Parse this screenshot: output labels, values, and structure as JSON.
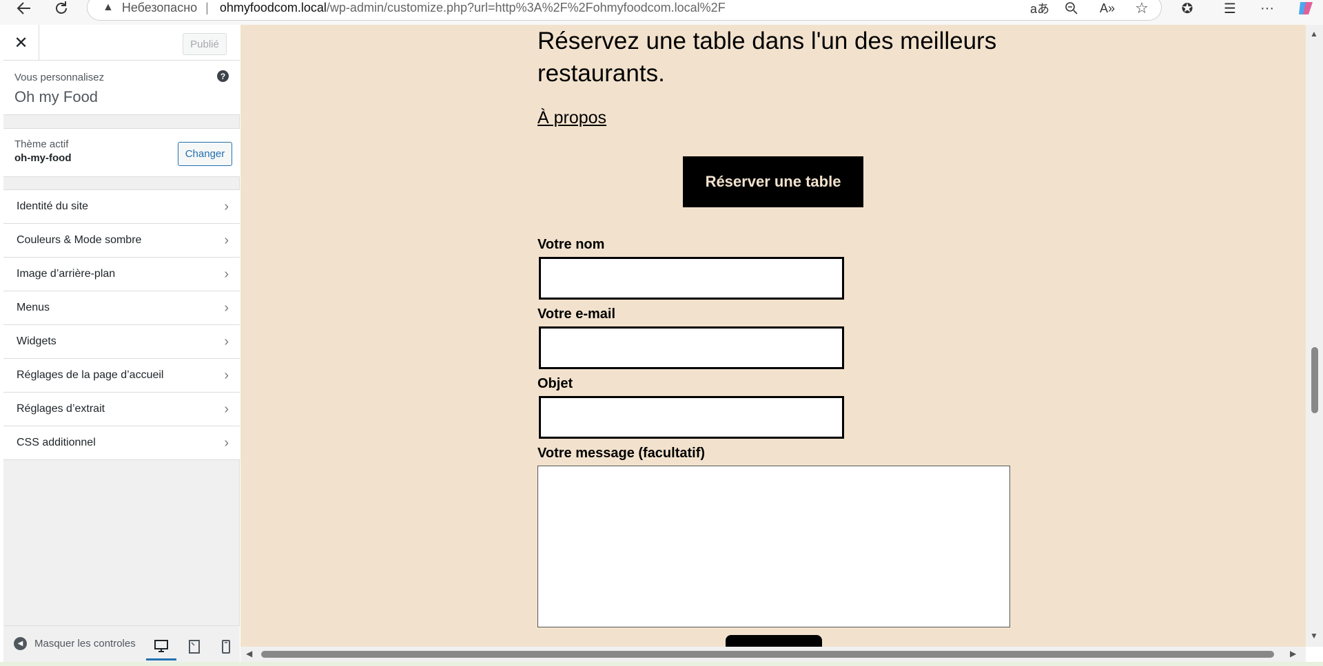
{
  "browser": {
    "back_icon": "arrow-left-icon",
    "refresh_icon": "refresh-icon",
    "security_label": "Небезопасно",
    "url_domain": "ohmyfoodcom.local",
    "url_path": "/wp-admin/customize.php?url=http%3A%2F%2Fohmyfoodcom.local%2F"
  },
  "sidebar": {
    "publish_label": "Publié",
    "customizing_label": "Vous personnalisez",
    "site_name": "Oh my Food",
    "theme_label": "Thème actif",
    "theme_name": "oh-my-food",
    "change_label": "Changer",
    "items": [
      {
        "label": "Identité du site"
      },
      {
        "label": "Couleurs & Mode sombre"
      },
      {
        "label": "Image d’arrière-plan"
      },
      {
        "label": "Menus"
      },
      {
        "label": "Widgets"
      },
      {
        "label": "Réglages de la page d’accueil"
      },
      {
        "label": "Réglages d’extrait"
      },
      {
        "label": "CSS additionnel"
      }
    ],
    "collapse_label": "Masquer les controles"
  },
  "preview": {
    "heading": "Réservez une table dans l'un des meilleurs restaurants.",
    "about_link": "À propos",
    "reserve_button": "Réserver une table",
    "fields": {
      "name_label": "Votre nom",
      "email_label": "Votre e-mail",
      "subject_label": "Objet",
      "message_label": "Votre message (facultatif)"
    }
  },
  "colors": {
    "preview_bg": "#f2e2cd",
    "accent": "#2271b1"
  }
}
